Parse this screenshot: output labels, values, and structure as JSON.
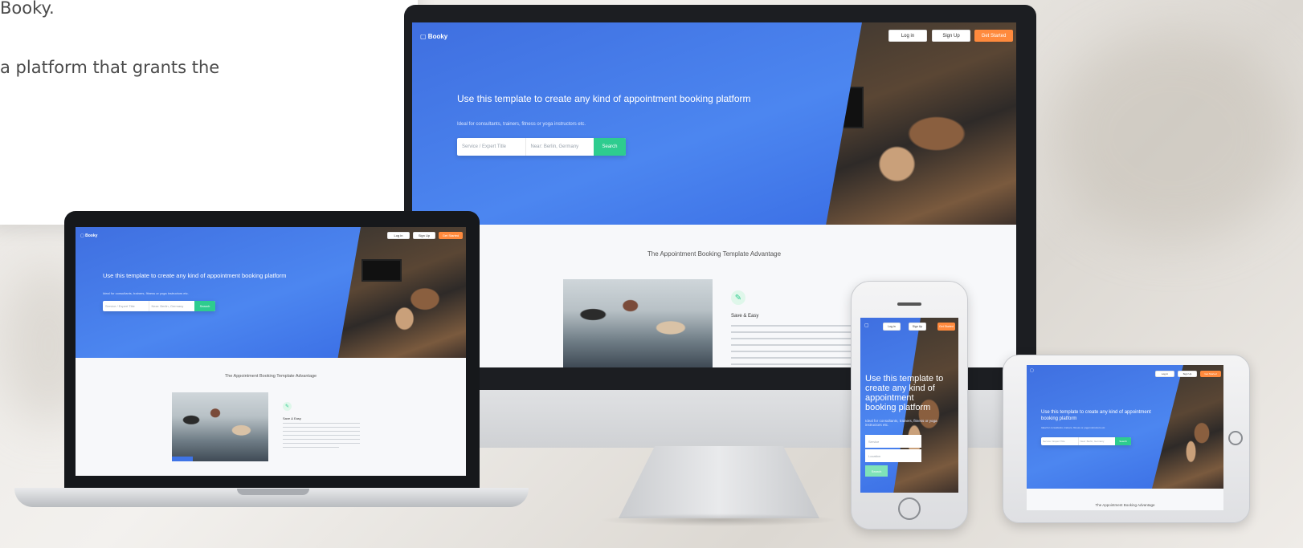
{
  "intro": {
    "line1": "Booky.",
    "line2": "a platform that grants the"
  },
  "site": {
    "logo_text": "Booky",
    "nav": {
      "login": "Log in",
      "signup": "Sign Up",
      "cta": "Get Started"
    },
    "headline": "Use this template to create any kind of appointment booking platform",
    "subheadline": "Ideal for consultants, trainers, fitness or yoga instructors etc.",
    "search": {
      "field1_placeholder": "Service / Expert Title",
      "field2_placeholder": "Near: Berlin, Germany",
      "button": "Search"
    },
    "section_title": "The Appointment Booking Template Advantage",
    "feature": {
      "title": "Save & Easy"
    }
  },
  "phone_site": {
    "headline": "Use this template to create any kind of appointment booking platform",
    "subheadline": "Ideal for consultants, trainers, fitness or yoga instructors etc.",
    "field1": "Service",
    "field2": "Location",
    "button": "Search"
  },
  "tablet_site": {
    "section_title": "The Appointment Booking Advantage"
  },
  "colors": {
    "brand_blue": "#4c86f0",
    "cta_orange": "#ff8a3d",
    "search_green": "#2ecc8f"
  }
}
